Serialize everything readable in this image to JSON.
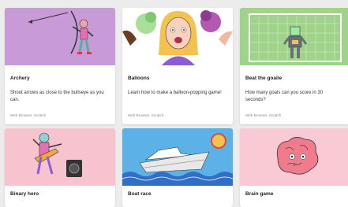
{
  "projects": [
    {
      "title": "Archery",
      "description": "Shoot arrows as close to the bullseye as you can.",
      "meta": "Web Browser, Scratch",
      "thumb_color": "#c99ad8",
      "icon": "archer-illustration"
    },
    {
      "title": "Balloons",
      "description": "Learn how to make a balloon-popping game!",
      "meta": "Web Browser, Scratch",
      "thumb_color": "#ffffff",
      "icon": "balloons-illustration"
    },
    {
      "title": "Beat the goalie",
      "description": "How many goals can you score in 30 seconds?",
      "meta": "Web Browser, Scratch",
      "thumb_color": "#9fd38a",
      "icon": "goalie-illustration"
    },
    {
      "title": "Binary hero",
      "thumb_color": "#f7c3cf",
      "icon": "guitarist-illustration"
    },
    {
      "title": "Boat race",
      "thumb_color": "#5cb2e6",
      "icon": "boat-illustration"
    },
    {
      "title": "Brain game",
      "thumb_color": "#f9c9d4",
      "icon": "brain-illustration"
    }
  ]
}
